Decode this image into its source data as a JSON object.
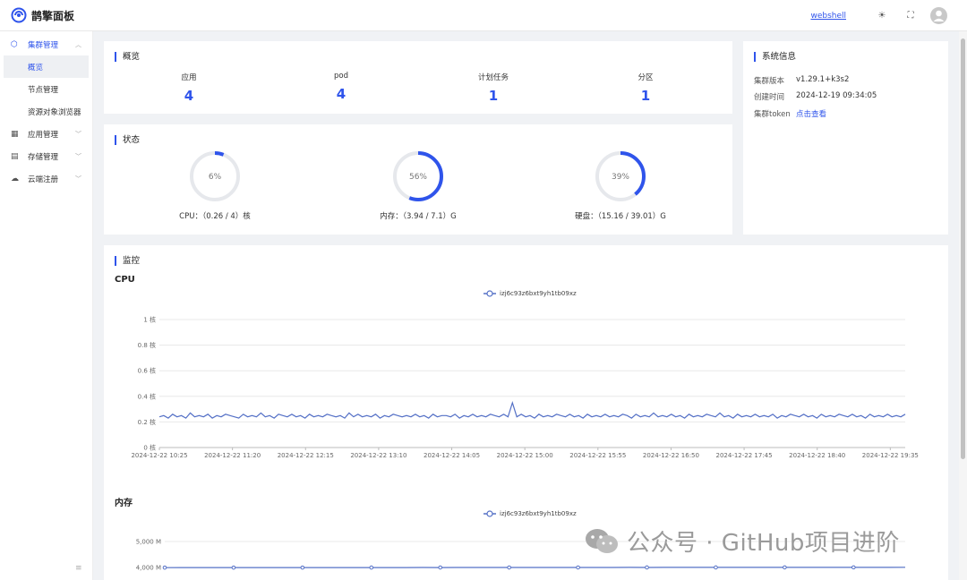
{
  "app": {
    "title": "鹊擎面板"
  },
  "topbar": {
    "webshell_label": "webshell",
    "theme_icon": "sun-icon",
    "fullscreen_icon": "fullscreen-icon",
    "avatar_icon": "user-avatar-icon"
  },
  "sidebar": {
    "groups": [
      {
        "label": "集群管理",
        "icon": "cube-icon",
        "expanded": true,
        "children": [
          {
            "label": "概览",
            "active": true
          },
          {
            "label": "节点管理"
          },
          {
            "label": "资源对象浏览器"
          }
        ]
      },
      {
        "label": "应用管理",
        "icon": "grid-icon",
        "expanded": false
      },
      {
        "label": "存储管理",
        "icon": "storage-icon",
        "expanded": false
      },
      {
        "label": "云端注册",
        "icon": "cloud-icon",
        "expanded": false
      }
    ]
  },
  "overview": {
    "title": "概览",
    "stats": [
      {
        "label": "应用",
        "value": "4"
      },
      {
        "label": "pod",
        "value": "4"
      },
      {
        "label": "计划任务",
        "value": "1"
      },
      {
        "label": "分区",
        "value": "1"
      }
    ]
  },
  "status": {
    "title": "状态",
    "gauges": [
      {
        "percent": 6,
        "percent_label": "6%",
        "caption": "CPU：（0.26 / 4）核"
      },
      {
        "percent": 56,
        "percent_label": "56%",
        "caption": "内存：（3.94 / 7.1）G"
      },
      {
        "percent": 39,
        "percent_label": "39%",
        "caption": "硬盘：（15.16 / 39.01）G"
      }
    ],
    "colors": {
      "track": "#e6e8ec",
      "fill": "#2f54eb"
    }
  },
  "system_info": {
    "title": "系统信息",
    "rows": [
      {
        "key": "集群版本",
        "value": "v1.29.1+k3s2"
      },
      {
        "key": "创建时间",
        "value": "2024-12-19 09:34:05"
      },
      {
        "key": "集群token",
        "value": "点击查看",
        "link": true
      }
    ]
  },
  "monitor": {
    "title": "监控"
  },
  "chart_data": [
    {
      "type": "line",
      "title": "CPU",
      "series": [
        {
          "name": "izj6c93z6bxt9yh1tb09xz",
          "color": "#5470c6",
          "values": [
            0.24,
            0.25,
            0.23,
            0.26,
            0.24,
            0.25,
            0.23,
            0.27,
            0.24,
            0.25,
            0.24,
            0.26,
            0.23,
            0.25,
            0.24,
            0.26,
            0.25,
            0.24,
            0.23,
            0.26,
            0.24,
            0.25,
            0.24,
            0.27,
            0.24,
            0.25,
            0.23,
            0.26,
            0.25,
            0.24,
            0.26,
            0.24,
            0.25,
            0.23,
            0.26,
            0.24,
            0.25,
            0.24,
            0.26,
            0.25,
            0.24,
            0.25,
            0.23,
            0.27,
            0.24,
            0.26,
            0.24,
            0.25,
            0.24,
            0.26,
            0.23,
            0.25,
            0.24,
            0.26,
            0.25,
            0.24,
            0.25,
            0.24,
            0.26,
            0.24,
            0.25,
            0.23,
            0.26,
            0.24,
            0.25,
            0.25,
            0.24,
            0.26,
            0.23,
            0.25,
            0.24,
            0.26,
            0.24,
            0.25,
            0.24,
            0.26,
            0.25,
            0.24,
            0.26,
            0.24,
            0.35,
            0.24,
            0.26,
            0.24,
            0.25,
            0.23,
            0.26,
            0.24,
            0.25,
            0.24,
            0.26,
            0.25,
            0.24,
            0.26,
            0.24,
            0.25,
            0.23,
            0.26,
            0.24,
            0.25,
            0.24,
            0.26,
            0.24,
            0.25,
            0.24,
            0.26,
            0.25,
            0.23,
            0.26,
            0.24,
            0.25,
            0.24,
            0.27,
            0.24,
            0.25,
            0.24,
            0.26,
            0.24,
            0.25,
            0.23,
            0.26,
            0.24,
            0.25,
            0.24,
            0.26,
            0.25,
            0.24,
            0.27,
            0.24,
            0.25,
            0.23,
            0.26,
            0.24,
            0.25,
            0.24,
            0.26,
            0.24,
            0.25,
            0.24,
            0.26,
            0.23,
            0.25,
            0.24,
            0.26,
            0.25,
            0.24,
            0.26,
            0.24,
            0.25,
            0.23,
            0.26,
            0.24,
            0.25,
            0.24,
            0.26,
            0.25,
            0.24,
            0.26,
            0.24,
            0.25,
            0.23,
            0.26,
            0.24,
            0.25,
            0.24,
            0.26,
            0.24,
            0.25,
            0.24,
            0.26
          ]
        }
      ],
      "x_ticks": [
        "2024-12-22 10:25",
        "2024-12-22 11:20",
        "2024-12-22 12:15",
        "2024-12-22 13:10",
        "2024-12-22 14:05",
        "2024-12-22 15:00",
        "2024-12-22 15:55",
        "2024-12-22 16:50",
        "2024-12-22 17:45",
        "2024-12-22 18:40",
        "2024-12-22 19:35"
      ],
      "y_ticks": [
        "0 核",
        "0.2 核",
        "0.4 核",
        "0.6 核",
        "0.8 核",
        "1 核"
      ],
      "ylim": [
        0,
        1
      ],
      "grid": true,
      "legend": "top-center"
    },
    {
      "type": "line",
      "title": "内存",
      "series": [
        {
          "name": "izj6c93z6bxt9yh1tb09xz",
          "color": "#5470c6",
          "values": [
            3994,
            3995,
            3995,
            3996,
            3995,
            3996,
            3996,
            3997,
            3996,
            3997,
            3997,
            3998,
            3997,
            3998,
            3998,
            3999,
            3998,
            3999,
            3999,
            4000,
            3999,
            4000,
            4000,
            4001,
            4000,
            4001,
            4001,
            4002,
            4001,
            4002,
            4002,
            4003,
            4002,
            4003,
            4003,
            4004,
            4003,
            4004,
            4004,
            4005,
            4004,
            4005,
            4005,
            4006
          ]
        }
      ],
      "y_ticks": [
        "4,000 M",
        "5,000 M"
      ],
      "grid": true,
      "legend": "top-center"
    }
  ],
  "watermark": {
    "text": "公众号 · GitHub项目进阶"
  }
}
